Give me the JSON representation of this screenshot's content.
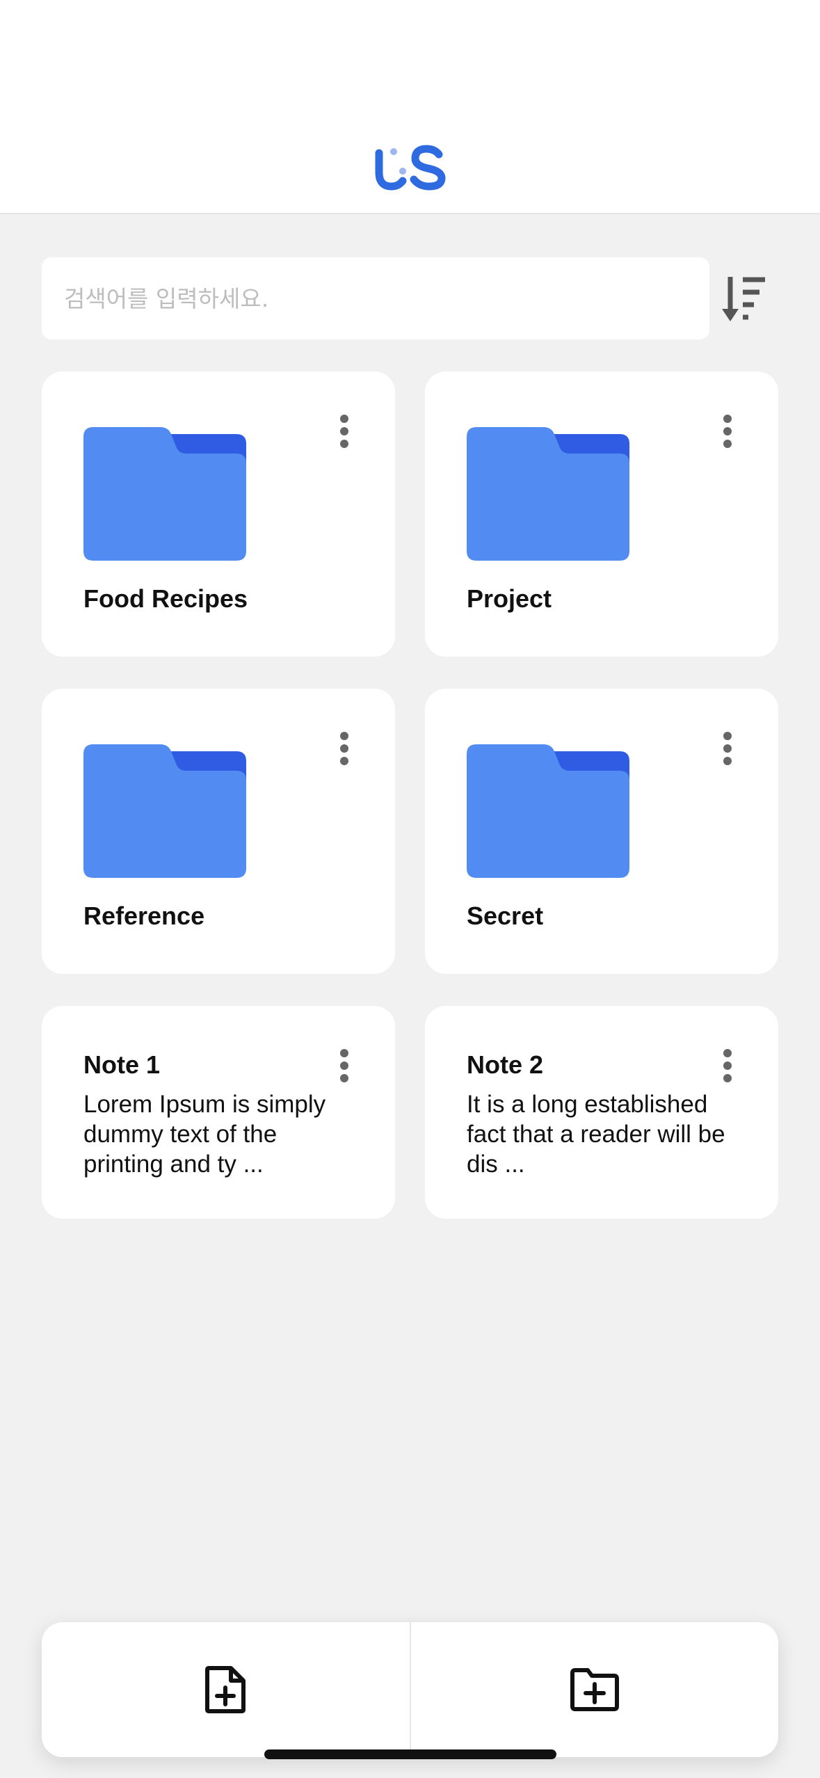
{
  "app": {
    "logo_name": "us-logo",
    "accent_color": "#2f6be0",
    "folder_color": "#528bf2",
    "folder_back_color": "#2f5ce3"
  },
  "search": {
    "placeholder": "검색어를 입력하세요.",
    "value": ""
  },
  "sort": {
    "icon": "sort-descending-icon"
  },
  "folders": [
    {
      "title": "Food Recipes"
    },
    {
      "title": "Project"
    },
    {
      "title": "Reference"
    },
    {
      "title": "Secret"
    }
  ],
  "notes": [
    {
      "title": "Note 1",
      "preview": "Lorem Ipsum is simply dummy text of the printing and ty ..."
    },
    {
      "title": "Note 2",
      "preview": "It is a long established fact that a reader will be dis ..."
    }
  ],
  "bottom_bar": {
    "new_note_icon": "file-plus-icon",
    "new_folder_icon": "folder-plus-icon"
  }
}
